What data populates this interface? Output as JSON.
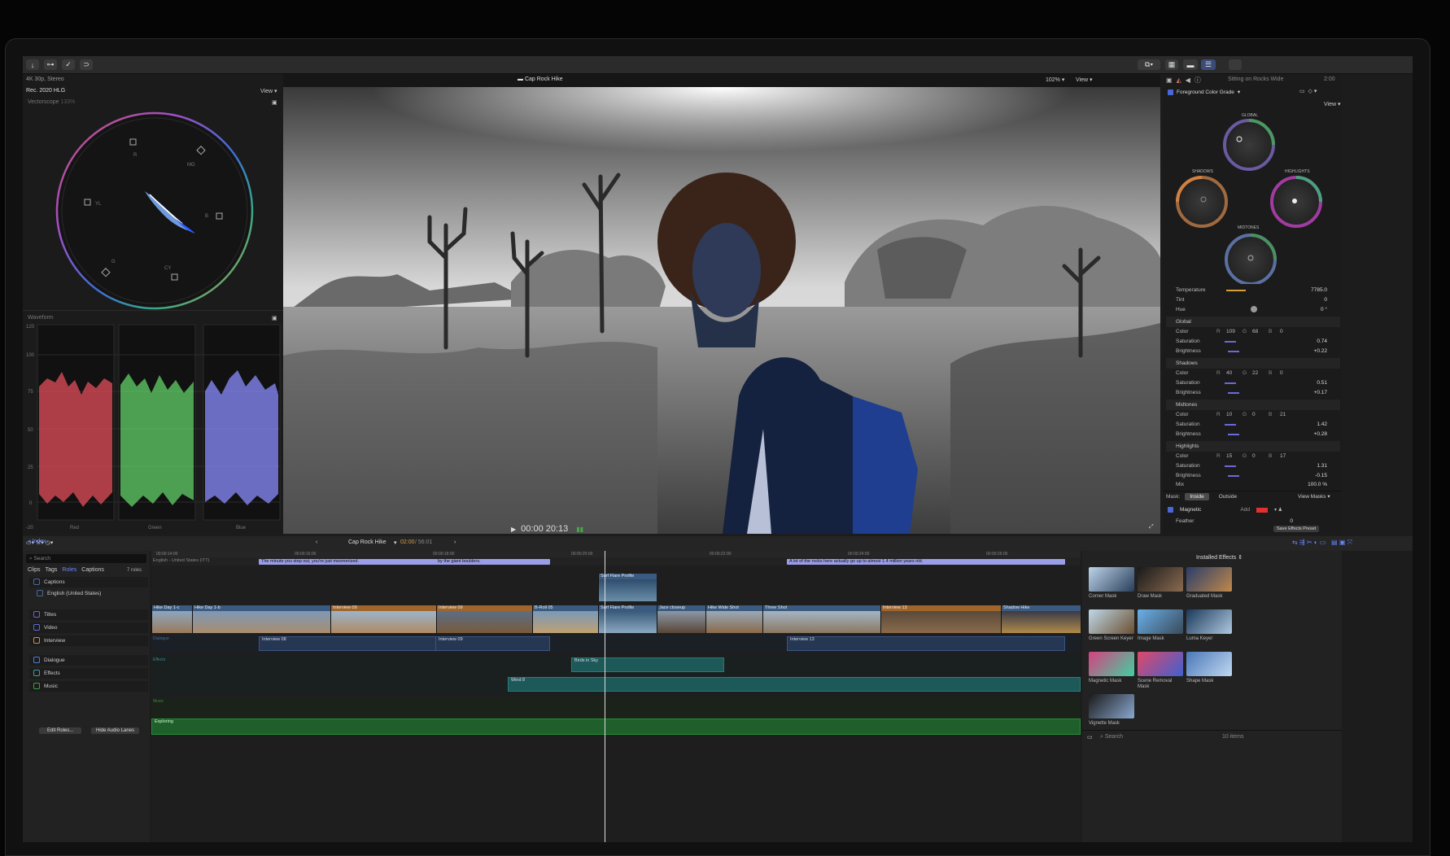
{
  "toolbar": {
    "share": "⇪"
  },
  "viewer": {
    "format": "4K 30p, Stereo",
    "title": "Cap Rock Hike",
    "zoom": "102%",
    "view": "View",
    "timecode": "00:00 20:13"
  },
  "scopes": {
    "colorspace": "Rec. 2020 HLG",
    "view": "View",
    "vectorscope_label": "Vectorscope",
    "vectorscope_pct": "133%",
    "vec_targets": [
      "R",
      "MG",
      "B",
      "CY",
      "G",
      "YL"
    ],
    "waveform_label": "Waveform",
    "wf_ticks": [
      "120",
      "100",
      "75",
      "50",
      "25",
      "0",
      "-20"
    ],
    "wf_channels": [
      "Red",
      "Green",
      "Blue"
    ]
  },
  "inspector": {
    "clip_name": "Sitting on Rocks Wide",
    "clip_dur": "2:00",
    "effect": "Foreground Color Grade",
    "view": "View",
    "wheels": {
      "global": "GLOBAL",
      "shadows": "SHADOWS",
      "highlights": "HIGHLIGHTS",
      "midtones": "MIDTONES"
    },
    "temperature": {
      "label": "Temperature",
      "value": "7785.0"
    },
    "tint": {
      "label": "Tint",
      "value": "0"
    },
    "hue": {
      "label": "Hue",
      "value": "0 °"
    },
    "sections": [
      {
        "name": "Global",
        "color": {
          "r": "109",
          "g": "68",
          "b": "0"
        },
        "saturation": "0.74",
        "brightness": "+0.22"
      },
      {
        "name": "Shadows",
        "color": {
          "r": "40",
          "g": "22",
          "b": "0"
        },
        "saturation": "0.51",
        "brightness": "+0.17"
      },
      {
        "name": "Midtones",
        "color": {
          "r": "10",
          "g": "0",
          "b": "21"
        },
        "saturation": "1.42",
        "brightness": "+0.28"
      },
      {
        "name": "Highlights",
        "color": {
          "r": "15",
          "g": "0",
          "b": "17"
        },
        "saturation": "1.31",
        "brightness": "-0.15"
      }
    ],
    "labels": {
      "color": "Color",
      "saturation": "Saturation",
      "brightness": "Brightness",
      "r": "R",
      "g": "G",
      "b": "B"
    },
    "mix": {
      "label": "Mix",
      "value": "100.0 %"
    },
    "mask": {
      "label": "Mask:",
      "inside": "Inside",
      "outside": "Outside",
      "view_masks": "View Masks",
      "magnetic": "Magnetic",
      "add": "Add",
      "feather": "Feather",
      "feather_val": "0",
      "save": "Save Effects Preset"
    }
  },
  "timeline": {
    "index": "Index",
    "project": "Cap Rock Hike",
    "position": "02:00",
    "duration": "56:01",
    "ruler": [
      "00:00:14:00",
      "00:00:16:00",
      "00:00:18:00",
      "00:00:20:00",
      "00:00:22:00",
      "00:00:24:00",
      "00:00:26:00"
    ],
    "caption_lane": "English - United States (ITT)",
    "captions": [
      "The minute you step out, you're just mesmerized.",
      "by the giant boulders.",
      "A lot of the rocks here actually go up to almost 1.4 million years old."
    ],
    "connected_clip": "Surf Flare Profile",
    "primary": [
      "Hike Day 1-c",
      "Hike Day 1-b",
      "Interview 09",
      "Interview 09",
      "B-Roll 05",
      "Surf Flare Profile",
      "Jace closeup",
      "Hike Wide Shot",
      "Three Shot",
      "Interview 13",
      "Shadow Hike"
    ],
    "lanes": {
      "dialogue": "Dialogue",
      "effects": "Effects",
      "music": "Music"
    },
    "dialogue": [
      "Interview 08",
      "Interview 09",
      "Interview 13"
    ],
    "effects_clips": [
      "Birds in Sky",
      "Wind 8"
    ],
    "music_clip": "Exploring"
  },
  "index": {
    "search": "Search",
    "tabs": [
      "Clips",
      "Tags",
      "Roles",
      "Captions"
    ],
    "count": "7 roles",
    "roles": [
      "Captions",
      "English (United States)",
      "Titles",
      "Video",
      "Interview",
      "Dialogue",
      "Effects",
      "Music"
    ],
    "edit_roles": "Edit Roles...",
    "hide_audio": "Hide Audio Lanes"
  },
  "browser": {
    "title": "Installed Effects",
    "items": [
      "Corner Mask",
      "Draw Mask",
      "Graduated Mask",
      "Green Screen Keyer",
      "Image Mask",
      "Luma Keyer",
      "Magnetic Mask",
      "Scene Removal Mask",
      "Shape Mask",
      "Vignette Mask"
    ],
    "search": "Search",
    "count": "10 items"
  }
}
